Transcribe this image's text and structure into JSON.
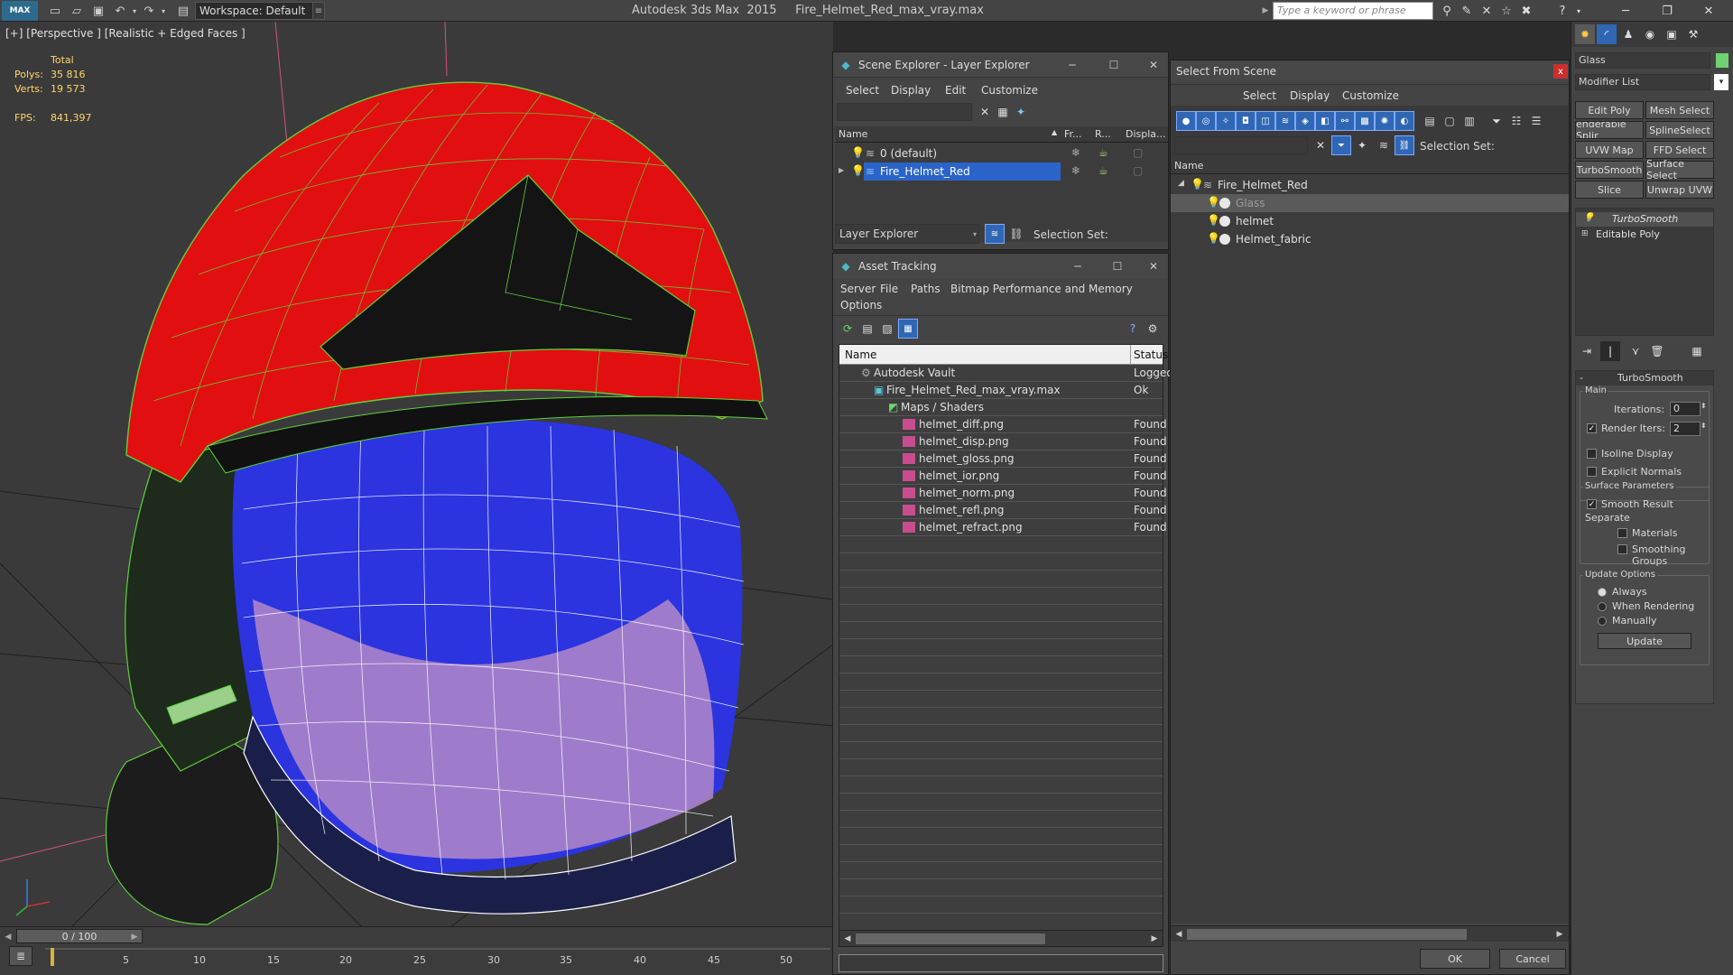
{
  "app": {
    "logo": "MAX",
    "workspace_label": "Workspace: Default",
    "title": "Autodesk 3ds Max  2015     Fire_Helmet_Red_max_vray.max",
    "search_placeholder": "Type a keyword or phrase"
  },
  "viewport": {
    "label": "[+] [Perspective ] [Realistic + Edged Faces ]",
    "stats_header": "Total",
    "polys_label": "Polys:",
    "polys_value": "35 816",
    "verts_label": "Verts:",
    "verts_value": "19 573",
    "fps_label": "FPS:",
    "fps_value": "841,397"
  },
  "timeline": {
    "frame": "0 / 100",
    "ticks": [
      "5",
      "10",
      "15",
      "20",
      "25",
      "30",
      "35",
      "40",
      "45",
      "50"
    ]
  },
  "scene_explorer": {
    "title": "Scene Explorer - Layer Explorer",
    "menu": [
      "Select",
      "Display",
      "Edit",
      "Customize"
    ],
    "columns": [
      "Name",
      "Fr...",
      "R...",
      "Displa..."
    ],
    "rows": [
      "0 (default)",
      "Fire_Helmet_Red"
    ],
    "footer_dropdown": "Layer Explorer",
    "selection_set_label": "Selection Set:"
  },
  "asset_tracking": {
    "title": "Asset Tracking",
    "menu": [
      "Server",
      "File",
      "Paths",
      "Bitmap Performance and Memory",
      "Options"
    ],
    "columns": [
      "Name",
      "Status"
    ],
    "rows": [
      {
        "name": "Autodesk Vault",
        "status": "Logged"
      },
      {
        "name": "Fire_Helmet_Red_max_vray.max",
        "status": "Ok"
      },
      {
        "name": "Maps / Shaders",
        "status": ""
      },
      {
        "name": "helmet_diff.png",
        "status": "Found"
      },
      {
        "name": "helmet_disp.png",
        "status": "Found"
      },
      {
        "name": "helmet_gloss.png",
        "status": "Found"
      },
      {
        "name": "helmet_ior.png",
        "status": "Found"
      },
      {
        "name": "helmet_norm.png",
        "status": "Found"
      },
      {
        "name": "helmet_refl.png",
        "status": "Found"
      },
      {
        "name": "helmet_refract.png",
        "status": "Found"
      }
    ]
  },
  "select_from_scene": {
    "title": "Select From Scene",
    "close": "x",
    "menu": [
      "Select",
      "Display",
      "Customize"
    ],
    "selection_set_label": "Selection Set:",
    "column": "Name",
    "tree": [
      "Fire_Helmet_Red",
      "Glass",
      "helmet",
      "Helmet_fabric"
    ],
    "ok_label": "OK",
    "cancel_label": "Cancel"
  },
  "command_panel": {
    "object_name": "Glass",
    "modifier_list": "Modifier List",
    "buttons": [
      "Edit Poly",
      "Mesh Select",
      "enderable Splir",
      "SplineSelect",
      "UVW Map",
      "FFD Select",
      "TurboSmooth",
      "Surface Select",
      "Slice",
      "Unwrap UVW"
    ],
    "stack": [
      "TurboSmooth",
      "Editable Poly"
    ],
    "rollout_title": "TurboSmooth",
    "main_label": "Main",
    "iterations_label": "Iterations:",
    "iterations_value": "0",
    "render_iters_label": "Render Iters:",
    "render_iters_value": "2",
    "isoline_label": "Isoline Display",
    "explicit_normals_label": "Explicit Normals",
    "surface_params_label": "Surface Parameters",
    "smooth_result_label": "Smooth Result",
    "separate_label": "Separate",
    "materials_label": "Materials",
    "smoothing_groups_label": "Smoothing Groups",
    "update_options_label": "Update Options",
    "always_label": "Always",
    "when_rendering_label": "When Rendering",
    "manually_label": "Manually",
    "update_button": "Update"
  },
  "colors": {
    "accent": "#2f67b5",
    "selection": "#2a64c8",
    "helmet_red": "#e01010",
    "visor_blue": "#2835e0"
  }
}
